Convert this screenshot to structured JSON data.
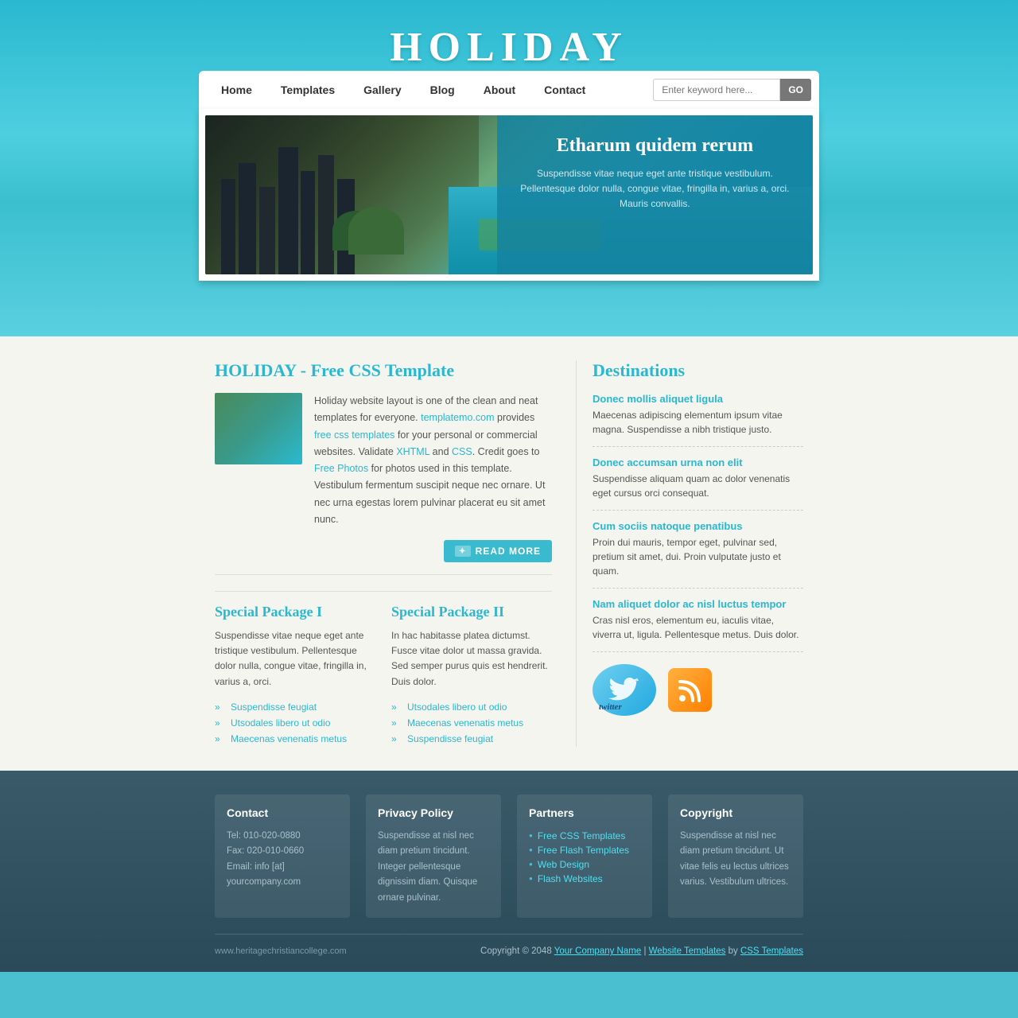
{
  "site": {
    "title": "HOLIDAY",
    "url": "www.heritagechristiancollege.com"
  },
  "nav": {
    "links": [
      {
        "label": "Home",
        "active": true
      },
      {
        "label": "Templates",
        "active": false
      },
      {
        "label": "Gallery",
        "active": false
      },
      {
        "label": "Blog",
        "active": false
      },
      {
        "label": "About",
        "active": false
      },
      {
        "label": "Contact",
        "active": false
      }
    ],
    "search_placeholder": "Enter keyword here...",
    "search_btn": "GO"
  },
  "hero": {
    "heading": "Etharum quidem rerum",
    "text": "Suspendisse vitae neque eget ante tristique vestibulum. Pellentesque dolor nulla, congue vitae, fringilla in, varius a, orci. Mauris convallis."
  },
  "about": {
    "section_title": "HOLIDAY - Free CSS Template",
    "text1": "Holiday website layout is one of the clean and neat templates for everyone.",
    "link1": "templatemo.com",
    "text2": "provides",
    "link2": "free css templates",
    "text3": "for your personal or commercial websites. Validate",
    "link3": "XHTML",
    "text4": "and",
    "link4": "CSS",
    "text5": ". Credit goes to",
    "link5": "Free Photos",
    "text6": "for photos used in this template. Vestibulum fermentum suscipit neque nec ornare. Ut nec urna egestas lorem pulvinar placerat eu sit amet nunc.",
    "read_more": "READ MORE"
  },
  "packages": {
    "package1": {
      "title": "Special Package I",
      "text": "Suspendisse vitae neque eget ante tristique vestibulum. Pellentesque dolor nulla, congue vitae, fringilla in, varius a, orci.",
      "items": [
        "Suspendisse feugiat",
        "Utsodales libero ut odio",
        "Maecenas venenatis metus"
      ]
    },
    "package2": {
      "title": "Special Package II",
      "text": "In hac habitasse platea dictumst. Fusce vitae dolor ut massa gravida. Sed semper purus quis est hendrerit. Duis dolor.",
      "items": [
        "Utsodales libero ut odio",
        "Maecenas venenatis metus",
        "Suspendisse feugiat"
      ]
    }
  },
  "destinations": {
    "section_title": "Destinations",
    "items": [
      {
        "title": "Donec mollis aliquet ligula",
        "text": "Maecenas adipiscing elementum ipsum vitae magna. Suspendisse a nibh tristique justo."
      },
      {
        "title": "Donec accumsan urna non elit",
        "text": "Suspendisse aliquam quam ac dolor venenatis eget cursus orci consequat."
      },
      {
        "title": "Cum sociis natoque penatibus",
        "text": "Proin dui mauris, tempor eget, pulvinar sed, pretium sit amet, dui. Proin vulputate justo et quam."
      },
      {
        "title": "Nam aliquet dolor ac nisl luctus tempor",
        "text": "Cras nisl eros, elementum eu, iaculis vitae, viverra ut, ligula. Pellentesque metus. Duis dolor."
      }
    ]
  },
  "footer": {
    "contact": {
      "title": "Contact",
      "tel": "Tel: 010-020-0880",
      "fax": "Fax: 020-010-0660",
      "email": "Email: info [at] yourcompany.com"
    },
    "privacy": {
      "title": "Privacy Policy",
      "text": "Suspendisse at nisl nec diam pretium tincidunt. Integer pellentesque dignissim diam. Quisque ornare pulvinar."
    },
    "partners": {
      "title": "Partners",
      "links": [
        "Free CSS Templates",
        "Free Flash Templates",
        "Web Design",
        "Flash Websites"
      ]
    },
    "copyright_col": {
      "title": "Copyright",
      "text": "Suspendisse at nisl nec diam pretium tincidunt. Ut vitae felis eu lectus ultrices varius. Vestibulum ultrices."
    },
    "bottom": {
      "site_url": "www.heritagechristiancollege.com",
      "copyright_text": "Copyright © 2048",
      "company_link": "Your Company Name",
      "separator": "|",
      "website_templates": "Website Templates",
      "by": "by",
      "css_templates": "CSS Templates"
    }
  }
}
